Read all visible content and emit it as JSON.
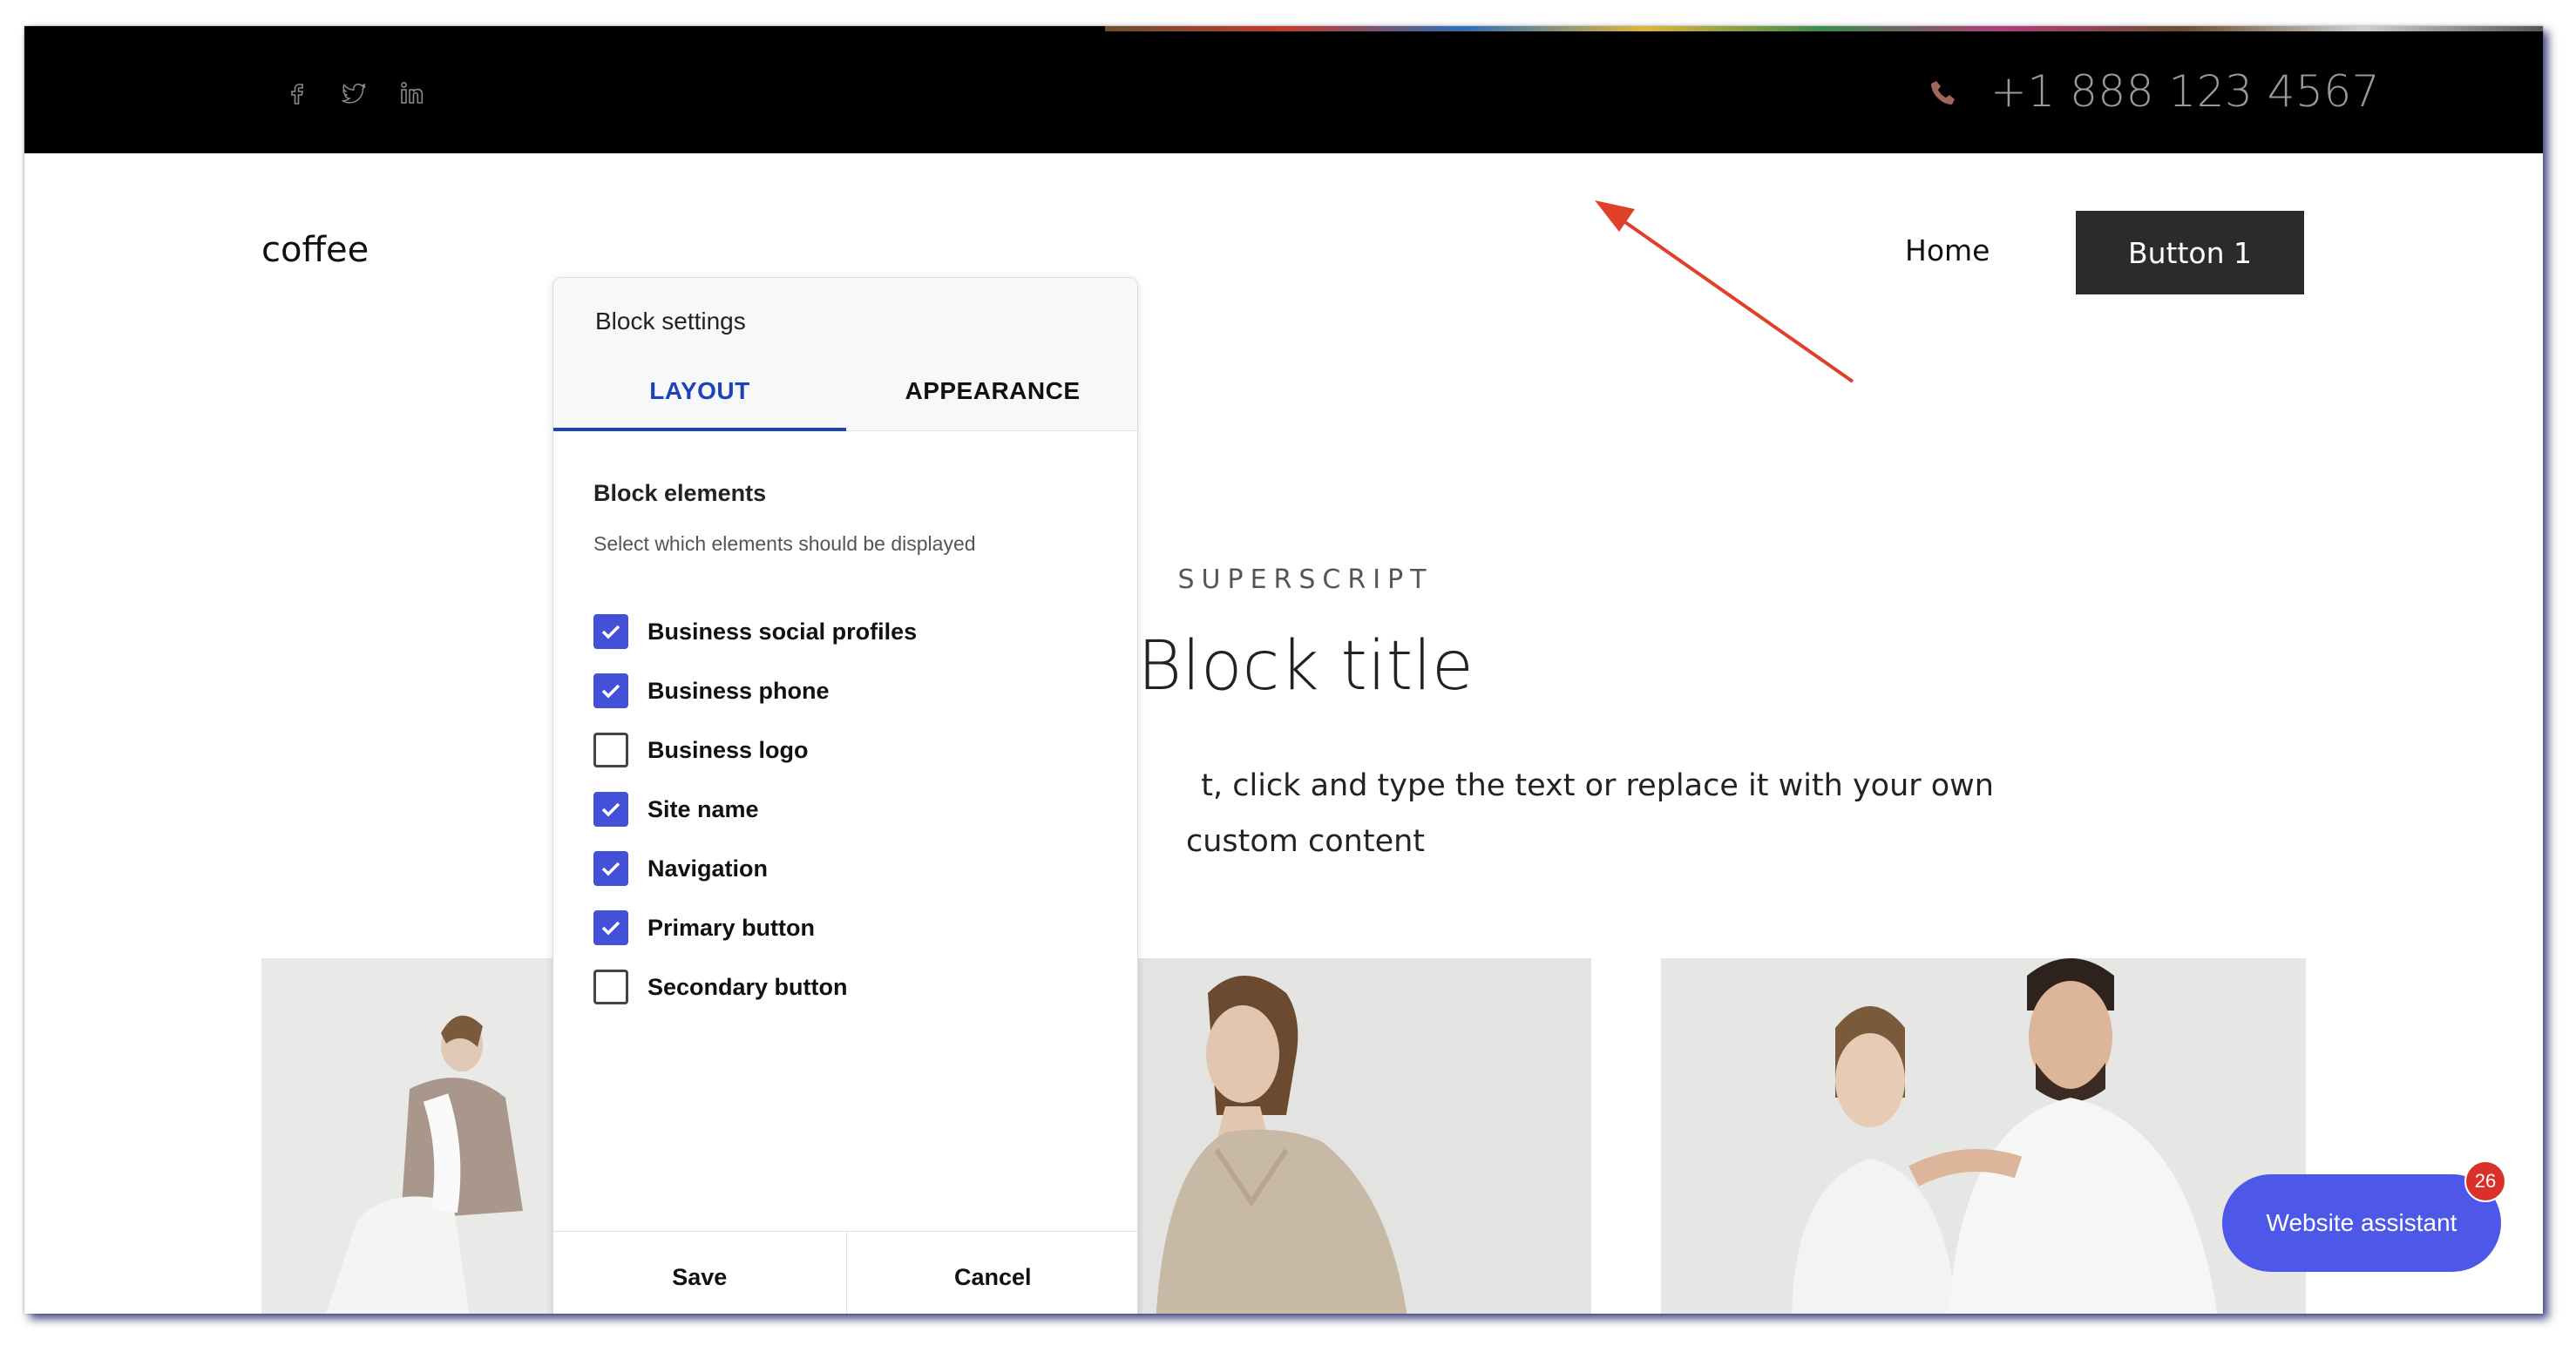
{
  "topbar": {
    "phone": "+1 888 123 4567",
    "social_icons": [
      "facebook-icon",
      "twitter-icon",
      "linkedin-icon"
    ]
  },
  "header": {
    "site_name": "coffee",
    "nav": {
      "home": "Home"
    },
    "primary_button": "Button 1"
  },
  "hero": {
    "superscript": "SUPERSCRIPT",
    "title": "Block title",
    "description_line1": "t, click and type the text or replace it with your own",
    "description_line2": "custom content"
  },
  "dialog": {
    "title": "Block settings",
    "tabs": [
      {
        "label": "LAYOUT",
        "active": true
      },
      {
        "label": "APPEARANCE",
        "active": false
      }
    ],
    "section_title": "Block elements",
    "section_subtitle": "Select which elements should be displayed",
    "elements": [
      {
        "label": "Business social profiles",
        "checked": true
      },
      {
        "label": "Business phone",
        "checked": true
      },
      {
        "label": "Business logo",
        "checked": false
      },
      {
        "label": "Site name",
        "checked": true
      },
      {
        "label": "Navigation",
        "checked": true
      },
      {
        "label": "Primary button",
        "checked": true
      },
      {
        "label": "Secondary button",
        "checked": false
      }
    ],
    "save_label": "Save",
    "cancel_label": "Cancel"
  },
  "assistant": {
    "label": "Website assistant",
    "badge_count": "26"
  },
  "colors": {
    "accent": "#4350d8",
    "tab_active": "#1a44b8",
    "badge": "#d9302a",
    "annotation_arrow": "#e0402a"
  }
}
